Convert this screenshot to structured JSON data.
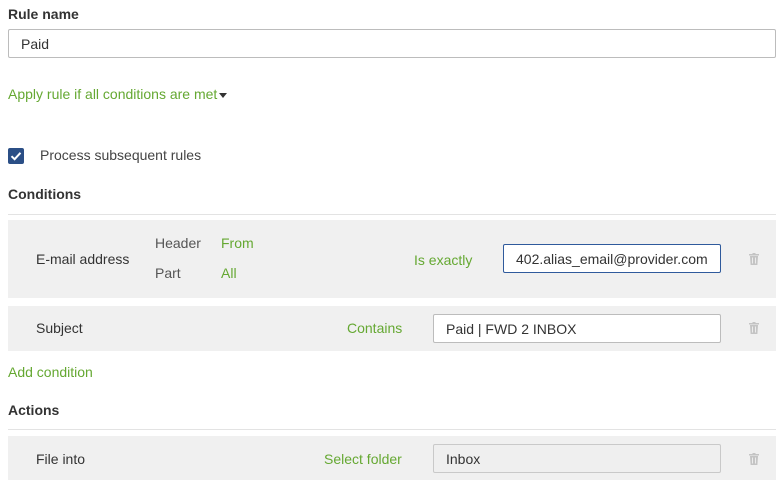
{
  "rule_name": {
    "label": "Rule name",
    "value": "Paid"
  },
  "apply_rule": {
    "label": "Apply rule if all conditions are met"
  },
  "process_subsequent": {
    "label": "Process subsequent rules",
    "checked": true
  },
  "conditions": {
    "heading": "Conditions",
    "rows": [
      {
        "field": "E-mail address",
        "header_label": "Header",
        "header_value": "From",
        "part_label": "Part",
        "part_value": "All",
        "operator": "Is exactly",
        "value": "402.alias_email@provider.com"
      },
      {
        "field": "Subject",
        "operator": "Contains",
        "value": "Paid | FWD 2 INBOX"
      }
    ],
    "add_label": "Add condition"
  },
  "actions": {
    "heading": "Actions",
    "rows": [
      {
        "action": "File into",
        "selector": "Select folder",
        "value": "Inbox"
      }
    ]
  },
  "colors": {
    "accent_green": "#65a832",
    "checkbox_blue": "#2b4f86",
    "row_bg": "#f0f0f0"
  }
}
